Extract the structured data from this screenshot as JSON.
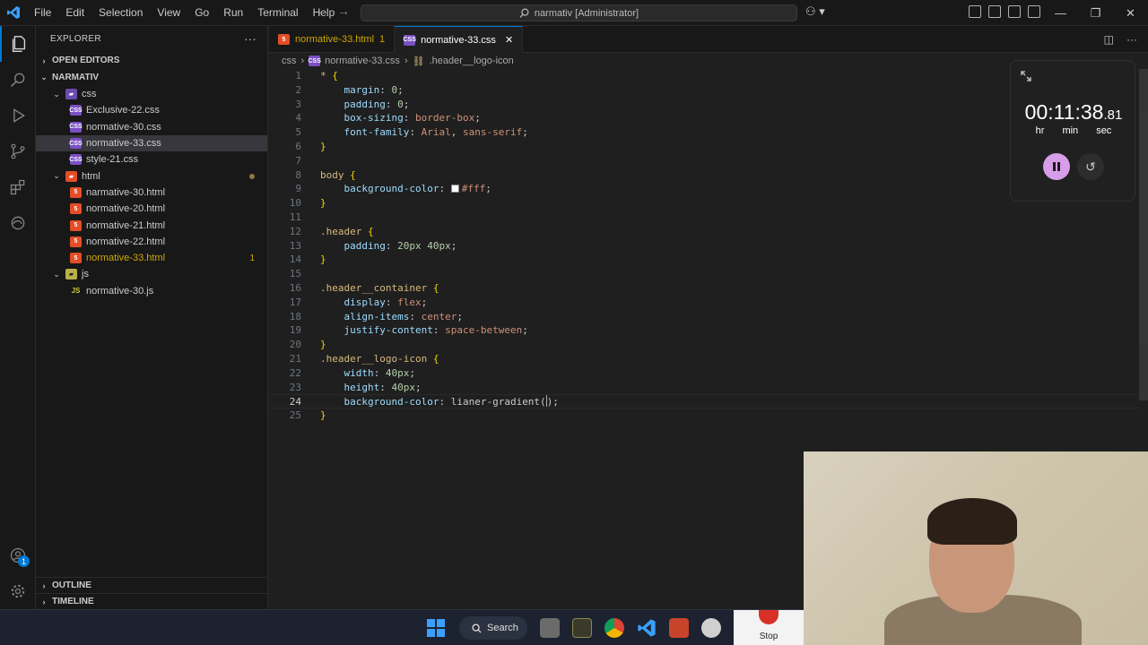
{
  "titlebar": {
    "menu": [
      "File",
      "Edit",
      "Selection",
      "View",
      "Go",
      "Run",
      "Terminal",
      "Help"
    ],
    "command_center": "narmativ [Administrator]"
  },
  "activity": {
    "accounts_badge": "1"
  },
  "sidebar": {
    "title": "EXPLORER",
    "more": "···",
    "open_editors": "OPEN EDITORS",
    "root": "NARMATIV",
    "tree": [
      {
        "label": "css",
        "kind": "folder-css",
        "depth": 1,
        "expanded": true
      },
      {
        "label": "Exclusive-22.css",
        "kind": "css",
        "depth": 2
      },
      {
        "label": "normative-30.css",
        "kind": "css",
        "depth": 2
      },
      {
        "label": "normative-33.css",
        "kind": "css",
        "depth": 2,
        "selected": true
      },
      {
        "label": "style-21.css",
        "kind": "css",
        "depth": 2
      },
      {
        "label": "html",
        "kind": "folder-html",
        "depth": 1,
        "expanded": true,
        "dot": true
      },
      {
        "label": "narmative-30.html",
        "kind": "html",
        "depth": 2
      },
      {
        "label": "normative-20.html",
        "kind": "html",
        "depth": 2
      },
      {
        "label": "normative-21.html",
        "kind": "html",
        "depth": 2
      },
      {
        "label": "normative-22.html",
        "kind": "html",
        "depth": 2
      },
      {
        "label": "normative-33.html",
        "kind": "html",
        "depth": 2,
        "modified": true,
        "count": "1"
      },
      {
        "label": "js",
        "kind": "folder-js",
        "depth": 1,
        "expanded": true
      },
      {
        "label": "normative-30.js",
        "kind": "js",
        "depth": 2
      }
    ],
    "outline": "OUTLINE",
    "timeline": "TIMELINE"
  },
  "tabs": [
    {
      "label": "normative-33.html",
      "badge": "1",
      "kind": "html",
      "active": false
    },
    {
      "label": "normative-33.css",
      "kind": "css",
      "active": true,
      "close": "✕"
    }
  ],
  "breadcrumb": {
    "folder": "css",
    "file": "normative-33.css",
    "symbol": ".header__logo-icon"
  },
  "editor": {
    "current_line": 24,
    "lines": [
      [
        [
          "sel",
          "* "
        ],
        [
          "brace",
          "{"
        ]
      ],
      [
        [
          "indent",
          ""
        ],
        [
          "prop",
          "margin"
        ],
        [
          "punc",
          ": "
        ],
        [
          "num",
          "0"
        ],
        [
          "punc",
          ";"
        ]
      ],
      [
        [
          "indent",
          ""
        ],
        [
          "prop",
          "padding"
        ],
        [
          "punc",
          ": "
        ],
        [
          "num",
          "0"
        ],
        [
          "punc",
          ";"
        ]
      ],
      [
        [
          "indent",
          ""
        ],
        [
          "prop",
          "box-sizing"
        ],
        [
          "punc",
          ": "
        ],
        [
          "val",
          "border-box"
        ],
        [
          "punc",
          ";"
        ]
      ],
      [
        [
          "indent",
          ""
        ],
        [
          "prop",
          "font-family"
        ],
        [
          "punc",
          ": "
        ],
        [
          "val",
          "Arial"
        ],
        [
          "punc",
          ", "
        ],
        [
          "val",
          "sans-serif"
        ],
        [
          "punc",
          ";"
        ]
      ],
      [
        [
          "brace",
          "}"
        ]
      ],
      [],
      [
        [
          "sel",
          "body "
        ],
        [
          "brace",
          "{"
        ]
      ],
      [
        [
          "indent",
          ""
        ],
        [
          "prop",
          "background-color"
        ],
        [
          "punc",
          ": "
        ],
        [
          "swatch",
          ""
        ],
        [
          "val",
          "#fff"
        ],
        [
          "punc",
          ";"
        ]
      ],
      [
        [
          "brace",
          "}"
        ]
      ],
      [],
      [
        [
          "sel",
          ".header "
        ],
        [
          "brace",
          "{"
        ]
      ],
      [
        [
          "indent",
          ""
        ],
        [
          "prop",
          "padding"
        ],
        [
          "punc",
          ": "
        ],
        [
          "num",
          "20px 40px"
        ],
        [
          "punc",
          ";"
        ]
      ],
      [
        [
          "brace",
          "}"
        ]
      ],
      [],
      [
        [
          "sel",
          ".header__container "
        ],
        [
          "brace",
          "{"
        ]
      ],
      [
        [
          "indent",
          ""
        ],
        [
          "prop",
          "display"
        ],
        [
          "punc",
          ": "
        ],
        [
          "val",
          "flex"
        ],
        [
          "punc",
          ";"
        ]
      ],
      [
        [
          "indent",
          ""
        ],
        [
          "prop",
          "align-items"
        ],
        [
          "punc",
          ": "
        ],
        [
          "val",
          "center"
        ],
        [
          "punc",
          ";"
        ]
      ],
      [
        [
          "indent",
          ""
        ],
        [
          "prop",
          "justify-content"
        ],
        [
          "punc",
          ": "
        ],
        [
          "val",
          "space-between"
        ],
        [
          "punc",
          ";"
        ]
      ],
      [
        [
          "brace",
          "}"
        ]
      ],
      [
        [
          "sel",
          ".header__logo-icon "
        ],
        [
          "brace",
          "{"
        ]
      ],
      [
        [
          "indent",
          ""
        ],
        [
          "prop",
          "width"
        ],
        [
          "punc",
          ": "
        ],
        [
          "num",
          "40px"
        ],
        [
          "punc",
          ";"
        ]
      ],
      [
        [
          "indent",
          ""
        ],
        [
          "prop",
          "height"
        ],
        [
          "punc",
          ": "
        ],
        [
          "num",
          "40px"
        ],
        [
          "punc",
          ";"
        ]
      ],
      [
        [
          "indent",
          ""
        ],
        [
          "prop",
          "background-color"
        ],
        [
          "punc",
          ": "
        ],
        [
          "punc",
          "lianer-gradient("
        ],
        [
          "caret",
          ""
        ],
        [
          "punc",
          ");"
        ]
      ],
      [
        [
          "brace",
          "}"
        ]
      ]
    ]
  },
  "clock": {
    "time_main": "00:11:38",
    "time_ms": ".81",
    "units": [
      "hr",
      "min",
      "sec"
    ]
  },
  "taskbar": {
    "search_label": "Search",
    "stop_label": "Stop"
  }
}
